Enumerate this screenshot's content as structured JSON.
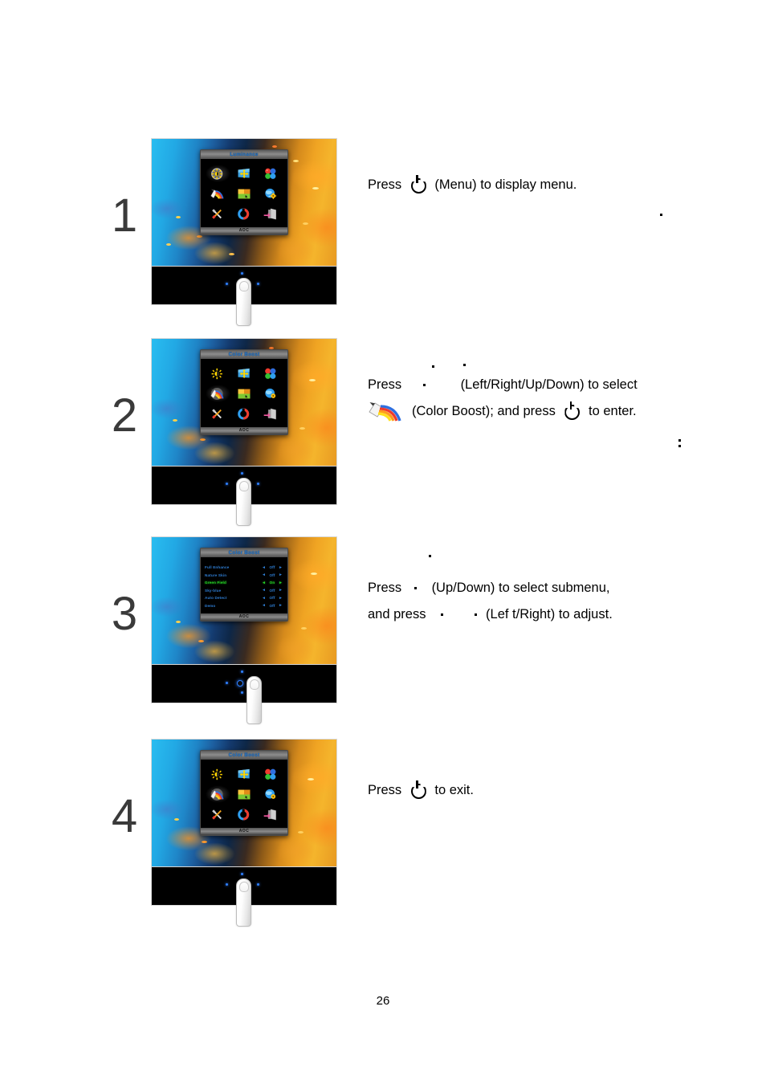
{
  "document": {
    "page_number": "26"
  },
  "osd": {
    "brand_logo": "AOC",
    "titles": {
      "luminance": "Luminance",
      "color_boost": "Color Boost"
    },
    "icons": [
      {
        "name": "luminance-icon",
        "label": "Luminance"
      },
      {
        "name": "image-setup-icon",
        "label": "Image Setup"
      },
      {
        "name": "color-setup-icon",
        "label": "Color Setup"
      },
      {
        "name": "color-boost-icon",
        "label": "Color Boost"
      },
      {
        "name": "picture-boost-icon",
        "label": "Picture Boost"
      },
      {
        "name": "osd-setup-icon",
        "label": "OSD Setup"
      },
      {
        "name": "extra-icon",
        "label": "Extra"
      },
      {
        "name": "reset-icon",
        "label": "Reset"
      },
      {
        "name": "exit-icon",
        "label": "Exit"
      }
    ],
    "submenu_rows": [
      {
        "label": "Full Enhance",
        "value": "Off",
        "left_arrow": "◄",
        "right_arrow": "►",
        "selected": false
      },
      {
        "label": "Nature Skin",
        "value": "Off",
        "left_arrow": "◄",
        "right_arrow": "►",
        "selected": false
      },
      {
        "label": "Green Field",
        "value": "On",
        "left_arrow": "◄",
        "right_arrow": "►",
        "selected": true
      },
      {
        "label": "Sky-blue",
        "value": "Off",
        "left_arrow": "◄",
        "right_arrow": "►",
        "selected": false
      },
      {
        "label": "Auto Detect",
        "value": "Off",
        "left_arrow": "◄",
        "right_arrow": "►",
        "selected": false
      },
      {
        "label": "Demo",
        "value": "Off",
        "left_arrow": "◄",
        "right_arrow": "►",
        "selected": false
      }
    ],
    "colors": {
      "menu_text": "#2f7fd6",
      "menu_selected": "#27d227",
      "title_text": "#1f7ad8"
    }
  },
  "steps": [
    {
      "number": "1",
      "osd_title": "Luminance",
      "text_line1_pre": "Press",
      "text_line1_post": "(Menu) to display menu.",
      "power_icon": "power-icon"
    },
    {
      "number": "2",
      "osd_title": "Color Boost",
      "text_line1_pre": "Press",
      "text_line1_post": "(Left/Right/Up/Down)  to  select",
      "text_line2_pre": "(Color  Boost); and press",
      "text_line2_post": "to  enter.",
      "power_icon": "power-icon",
      "color_boost_icon": "color-boost-icon"
    },
    {
      "number": "3",
      "osd_title": "Color Boost",
      "text_line1_pre": "Press",
      "text_line1_post": "(Up/Down) to select submenu,",
      "text_line2_pre": "and press",
      "text_line2_post": "(Lef t/Right) to adjust."
    },
    {
      "number": "4",
      "osd_title": "Color Boost",
      "text_line1_pre": "Press",
      "text_line1_post": "to  exit.",
      "power_icon": "power-icon"
    }
  ]
}
